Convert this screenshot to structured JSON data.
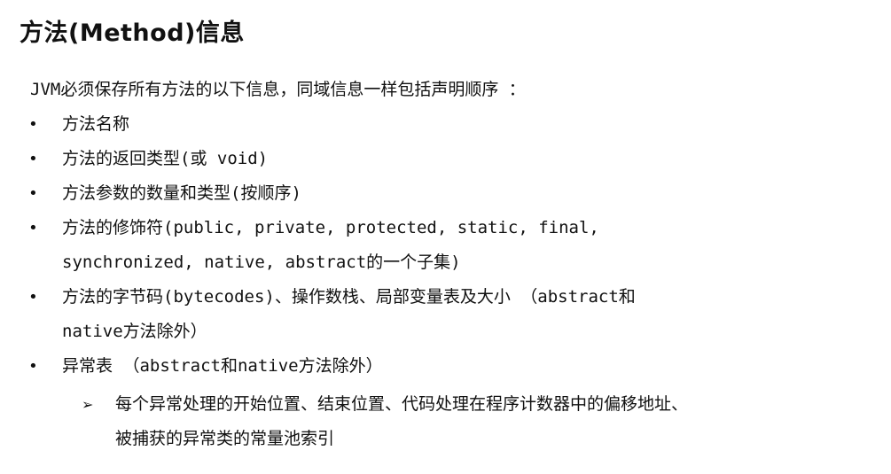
{
  "slide": {
    "title": "方法(Method)信息",
    "intro": "JVM必须保存所有方法的以下信息，同域信息一样包括声明顺序 ：",
    "bullet_glyph": "•",
    "bullets": [
      {
        "lines": [
          "方法名称"
        ]
      },
      {
        "lines": [
          "方法的返回类型(或 void)"
        ]
      },
      {
        "lines": [
          "方法参数的数量和类型(按顺序)"
        ]
      },
      {
        "lines": [
          "方法的修饰符(public, private, protected, static, final,",
          "synchronized, native, abstract的一个子集)"
        ]
      },
      {
        "lines": [
          "方法的字节码(bytecodes)、操作数栈、局部变量表及大小 （abstract和",
          "native方法除外）"
        ]
      },
      {
        "lines": [
          "异常表  （abstract和native方法除外）"
        ]
      }
    ],
    "sub_glyph": "➢",
    "sub_bullet": {
      "lines": [
        "每个异常处理的开始位置、结束位置、代码处理在程序计数器中的偏移地址、",
        "被捕获的异常类的常量池索引"
      ]
    }
  }
}
